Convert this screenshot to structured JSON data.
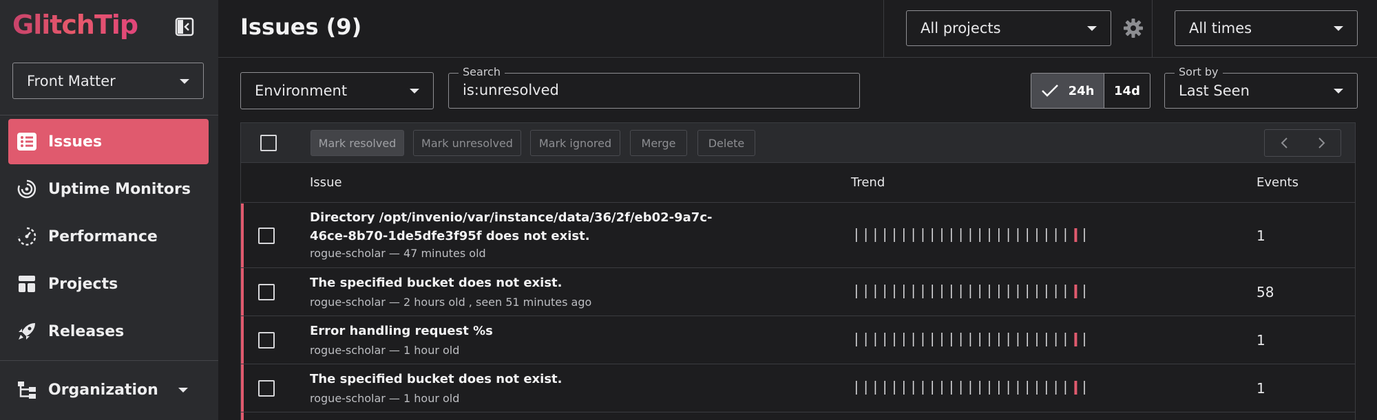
{
  "app": {
    "logo": "GlitchTip"
  },
  "sidebar": {
    "org": "Front Matter",
    "items": [
      {
        "label": "Issues",
        "icon": "issues-list-icon",
        "active": true
      },
      {
        "label": "Uptime Monitors",
        "icon": "uptime-icon"
      },
      {
        "label": "Performance",
        "icon": "performance-icon"
      },
      {
        "label": "Projects",
        "icon": "projects-icon"
      },
      {
        "label": "Releases",
        "icon": "rocket-icon"
      },
      {
        "label": "Organization",
        "icon": "org-tree-icon"
      }
    ]
  },
  "header": {
    "title": "Issues (9)",
    "projects": "All projects",
    "times": "All times"
  },
  "filters": {
    "environment": "Environment",
    "search_label": "Search",
    "search_value": "is:unresolved",
    "range_24h": "24h",
    "range_14d": "14d",
    "sort_label": "Sort by",
    "sort_value": "Last Seen"
  },
  "actions": {
    "mark_resolved": "Mark resolved",
    "mark_unresolved": "Mark unresolved",
    "mark_ignored": "Mark ignored",
    "merge": "Merge",
    "delete": "Delete"
  },
  "table": {
    "columns": {
      "issue": "Issue",
      "trend": "Trend",
      "events": "Events"
    },
    "rows": [
      {
        "title": "Directory /opt/invenio/var/instance/data/36/2f/eb02-9a7c-46ce-8b70-1de5dfe3f95f does not exist.",
        "meta": "rogue-scholar — 47 minutes old",
        "events": "1"
      },
      {
        "title": "The specified bucket does not exist.",
        "meta": "rogue-scholar — 2 hours old , seen 51 minutes ago",
        "events": "58"
      },
      {
        "title": "Error handling request %s",
        "meta": "rogue-scholar — 1 hour old",
        "events": "1"
      },
      {
        "title": "The specified bucket does not exist.",
        "meta": "rogue-scholar — 1 hour old",
        "events": "1"
      }
    ]
  },
  "colors": {
    "accent": "#e05a6e",
    "trend_tick": "#d7d7da"
  }
}
